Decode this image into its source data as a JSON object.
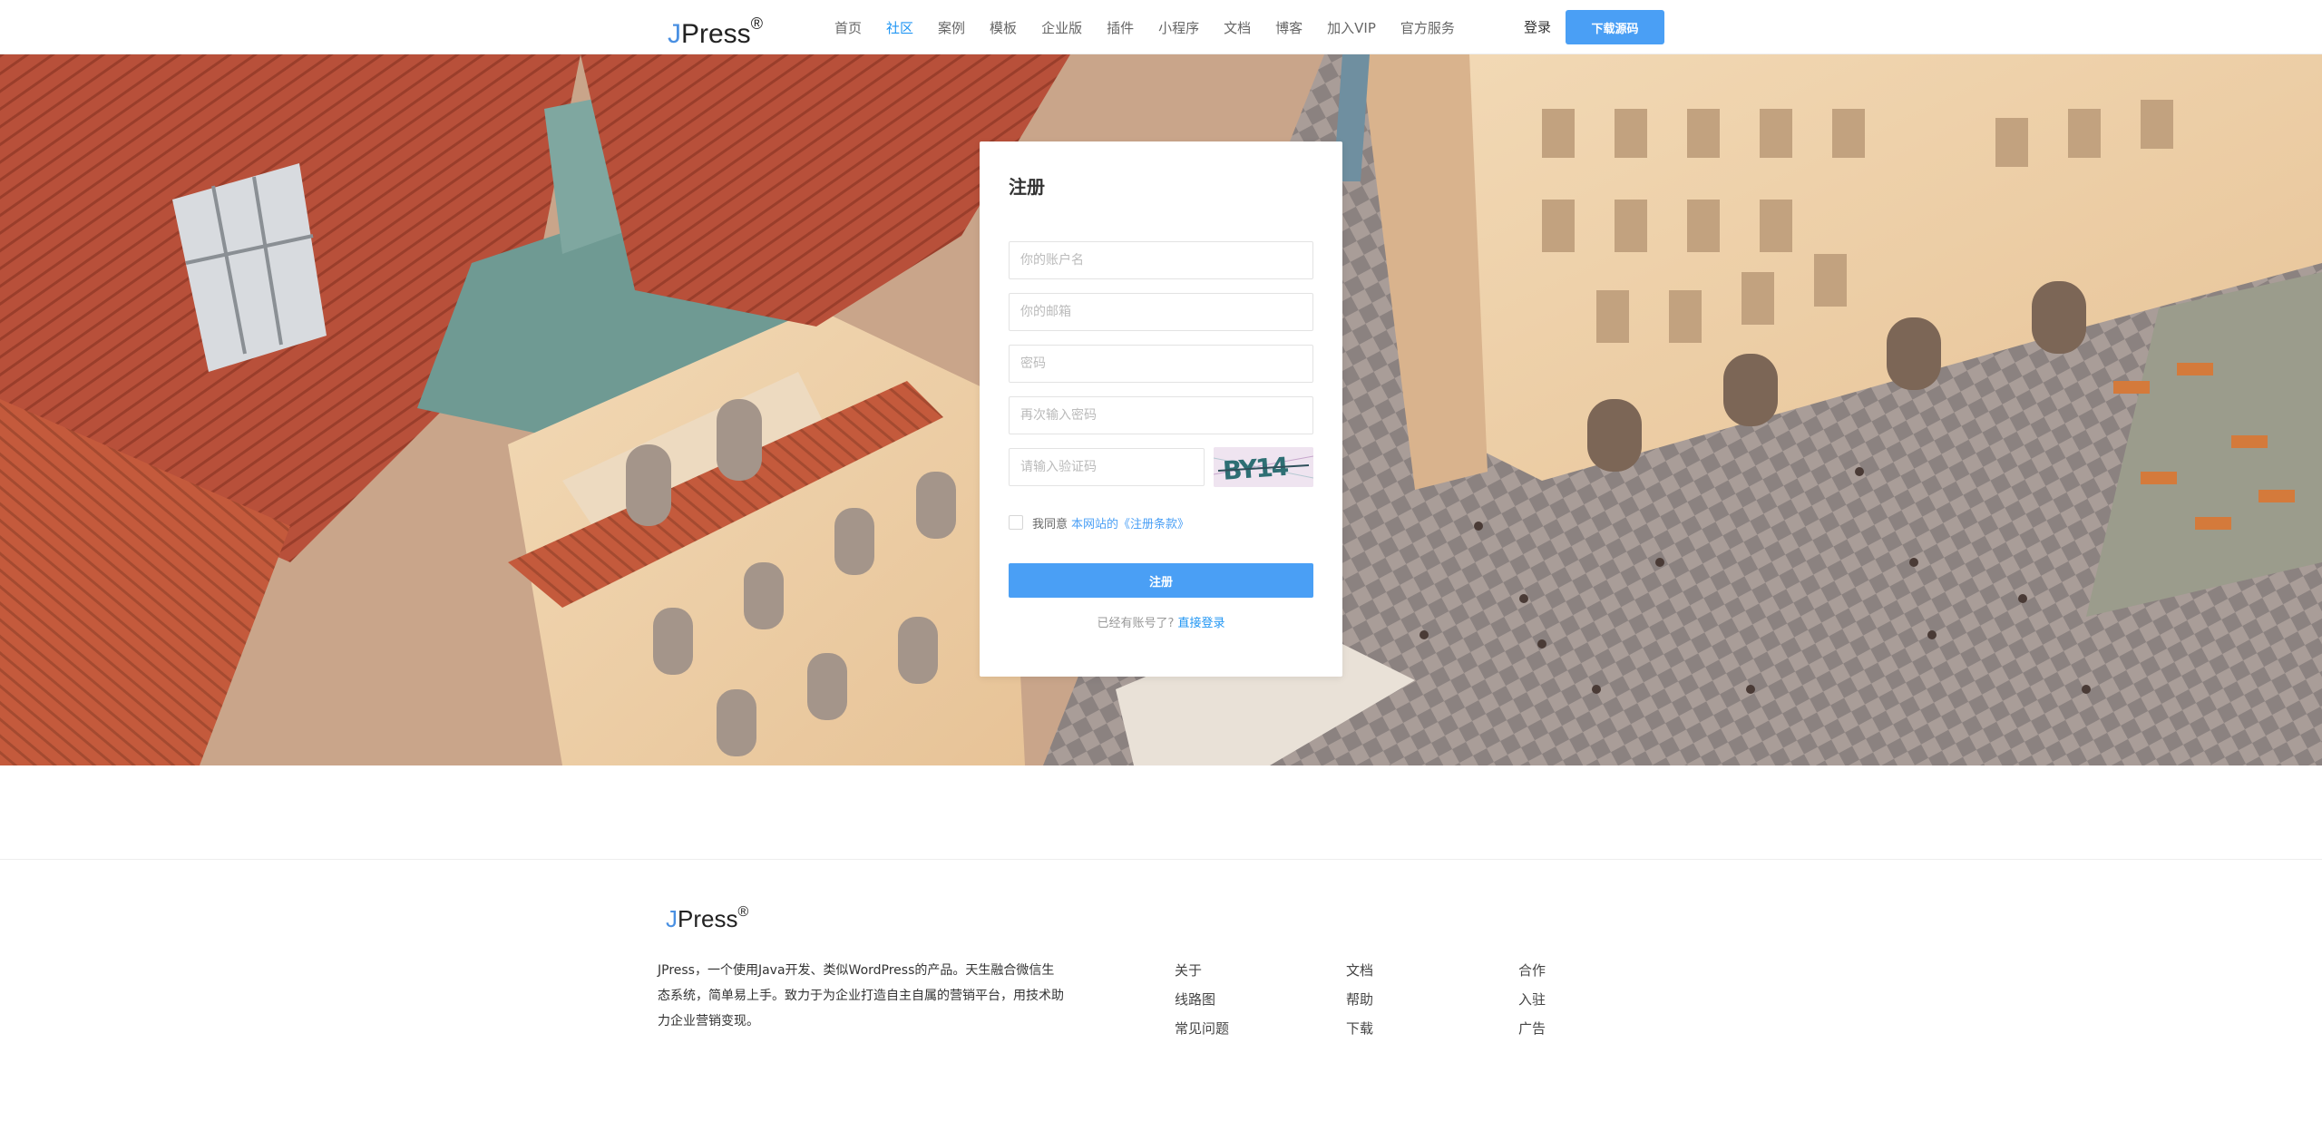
{
  "header": {
    "logo_j": "J",
    "logo_rest": "Press",
    "logo_reg": "®",
    "nav": [
      "首页",
      "社区",
      "案例",
      "模板",
      "企业版",
      "插件",
      "小程序",
      "文档",
      "博客",
      "加入VIP",
      "官方服务"
    ],
    "active_nav": "社区",
    "login": "登录",
    "download": "下载源码"
  },
  "register": {
    "title": "注册",
    "username_placeholder": "你的账户名",
    "email_placeholder": "你的邮箱",
    "password_placeholder": "密码",
    "confirm_placeholder": "再次输入密码",
    "captcha_placeholder": "请输入验证码",
    "captcha_text": "BY14",
    "agree_text": "我同意",
    "terms_text": "本网站的《注册条款》",
    "submit": "注册",
    "has_account": "已经有账号了?",
    "direct_login": "直接登录"
  },
  "footer": {
    "logo_j": "J",
    "logo_rest": "Press",
    "logo_reg": "®",
    "description": "JPress，一个使用Java开发、类似WordPress的产品。天生融合微信生态系统，简单易上手。致力于为企业打造自主自属的营销平台，用技术助力企业营销变现。",
    "col1": [
      "关于",
      "线路图",
      "常见问题"
    ],
    "col2": [
      "文档",
      "帮助",
      "下载"
    ],
    "col3": [
      "合作",
      "入驻",
      "广告"
    ]
  },
  "colors": {
    "accent": "#4a9ff5",
    "active_nav": "#2196f3"
  }
}
